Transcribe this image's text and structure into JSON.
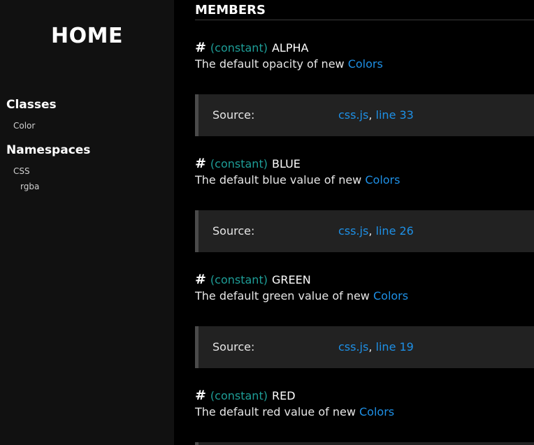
{
  "sidebar": {
    "home_label": "HOME",
    "classes_heading": "Classes",
    "classes": [
      "Color"
    ],
    "namespaces_heading": "Namespaces",
    "namespaces": [
      "CSS",
      "rgba"
    ]
  },
  "main": {
    "section_title": "MEMBERS",
    "source_label": "Source:",
    "members": [
      {
        "hash": "#",
        "attribute": "(constant)",
        "name": "ALPHA",
        "description": "The default opacity of new",
        "link": "Colors",
        "file": "css.js",
        "separator": ",",
        "line": "line 33"
      },
      {
        "hash": "#",
        "attribute": "(constant)",
        "name": "BLUE",
        "description": "The default blue value of new",
        "link": "Colors",
        "file": "css.js",
        "separator": ",",
        "line": "line 26"
      },
      {
        "hash": "#",
        "attribute": "(constant)",
        "name": "GREEN",
        "description": "The default green value of new",
        "link": "Colors",
        "file": "css.js",
        "separator": ",",
        "line": "line 19"
      },
      {
        "hash": "#",
        "attribute": "(constant)",
        "name": "RED",
        "description": "The default red value of new",
        "link": "Colors"
      }
    ]
  },
  "colors": {
    "sidebar_bg": "#111111",
    "main_bg": "#000000",
    "attribute": "#1e9e98",
    "link": "#1e90e6",
    "source_bg": "#222222"
  }
}
